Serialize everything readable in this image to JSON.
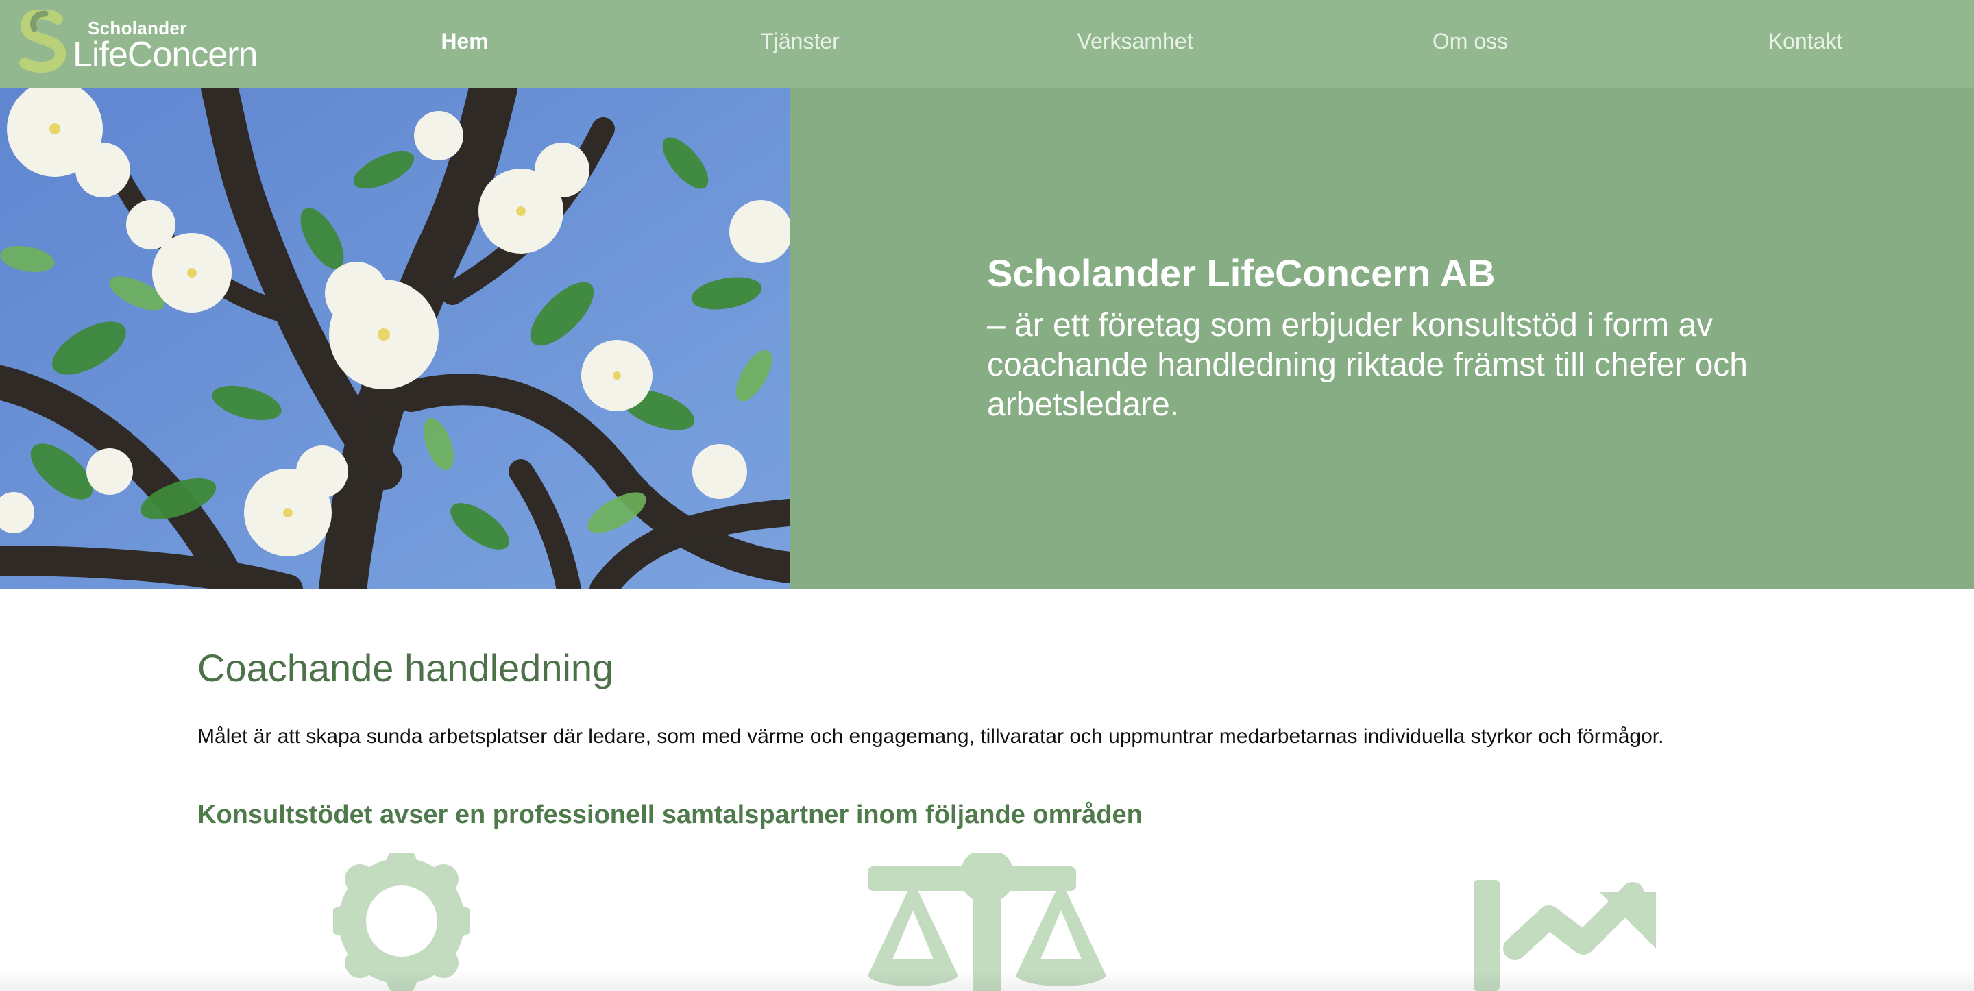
{
  "brand": {
    "name_small": "Scholander",
    "name_big": "LifeConcern"
  },
  "nav": {
    "items": [
      {
        "label": "Hem",
        "active": true
      },
      {
        "label": "Tjänster",
        "active": false
      },
      {
        "label": "Verksamhet",
        "active": false
      },
      {
        "label": "Om oss",
        "active": false
      },
      {
        "label": "Kontakt",
        "active": false
      }
    ]
  },
  "hero": {
    "title": "Scholander LifeConcern AB",
    "text": "– är ett företag som erbjuder konsultstöd i form av coachande handledning riktade främst till chefer och arbetsledare."
  },
  "content": {
    "title": "Coachande handledning",
    "intro": "Målet är att skapa sunda arbetsplatser där ledare, som med värme och engagemang, tillvaratar och uppmuntrar medarbetarnas individuella styrkor och förmågor.",
    "subheading": "Konsultstödet avser en professionell samtalspartner inom följande områden",
    "areas": [
      {
        "icon": "award-icon"
      },
      {
        "icon": "scale-icon"
      },
      {
        "icon": "growth-chart-icon"
      }
    ]
  },
  "colors": {
    "header_bg": "#93b890",
    "hero_panel_bg": "#87ad85",
    "heading_green": "#4d7149",
    "icon_green": "#c3dcc0",
    "sky_blue": "#6c8fd1"
  }
}
